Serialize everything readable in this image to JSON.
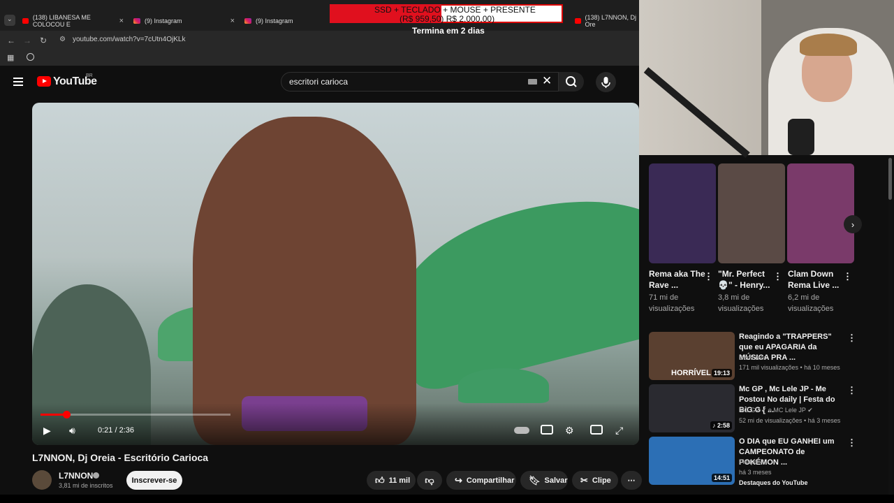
{
  "browser": {
    "tabs": [
      {
        "title": "(138) LIBANESA ME COLOCOU E",
        "close": "×",
        "favicon": "youtube"
      },
      {
        "title": "(9) Instagram",
        "close": "×",
        "favicon": "instagram"
      },
      {
        "title": "(9) Instagram",
        "close": "",
        "favicon": "instagram"
      },
      {
        "title": "(138) L7NNON, Dj Ore",
        "close": "",
        "favicon": "youtube"
      }
    ],
    "url": "youtube.com/watch?v=7cUtn4OjKLk"
  },
  "promo": {
    "line1": "SSD + TECLADO + MOUSE + PRESENTE",
    "line2": "(R$ 959,50) R$ 2.000,00)",
    "ends": "Termina em 2 dias"
  },
  "youtube": {
    "logo_text": "YouTube",
    "country": "BR",
    "search_value": "escritori carioca"
  },
  "player": {
    "current_time": "0:21",
    "duration": "2:36",
    "time_display": "0:21 / 2:36",
    "progress_fraction": 0.135
  },
  "video": {
    "title": "L7NNON, Dj Oreia - Escritório Carioca",
    "channel": "L7NNON",
    "subscribers": "3,81 mi de inscritos",
    "subscribe_label": "Inscrever-se",
    "likes": "11 mil",
    "share_label": "Compartilhar",
    "save_label": "Salvar",
    "clip_label": "Clipe",
    "more_label": "⋯"
  },
  "shorts": [
    {
      "title": "Rema aka The Rave ...",
      "views": "71 mi de visualizações",
      "color": "#3a2a55"
    },
    {
      "title": "\"Mr. Perfect 💀\" - Henry...",
      "views": "3,8 mi de visualizações",
      "color": "#5a4a45"
    },
    {
      "title": "Clam Down Rema Live ...",
      "views": "6,2 mi de visualizações",
      "color": "#7a3a6a"
    }
  ],
  "recommendations": [
    {
      "title": "Reagindo a \"TRAPPERS\" que eu APAGARIA da MÚSICA PRA ...",
      "channel": "DeniLives",
      "meta": "171 mil visualizações • há 10 meses",
      "duration": "19:13",
      "overlay": "HORRÍVEL",
      "color": "#5a4030"
    },
    {
      "title": "Mc GP , Mc Lele JP - Me Postou No daily | Festa do BiG G [ ...",
      "channel": "MC GP ✔ e MC Lele JP ✔",
      "meta": "52 mi de visualizações • há 3 meses",
      "duration": "♪ 2:58",
      "overlay": "",
      "color": "#2a2a30"
    },
    {
      "title": "O DIA que EU GANHEI um CAMPEONATO de POKÉMON ...",
      "channel": "Fiaspo ✔",
      "meta": "há 3 meses",
      "extra": "Destaques do YouTube",
      "duration": "14:51",
      "overlay": "",
      "color": "#2c6fb5"
    }
  ]
}
